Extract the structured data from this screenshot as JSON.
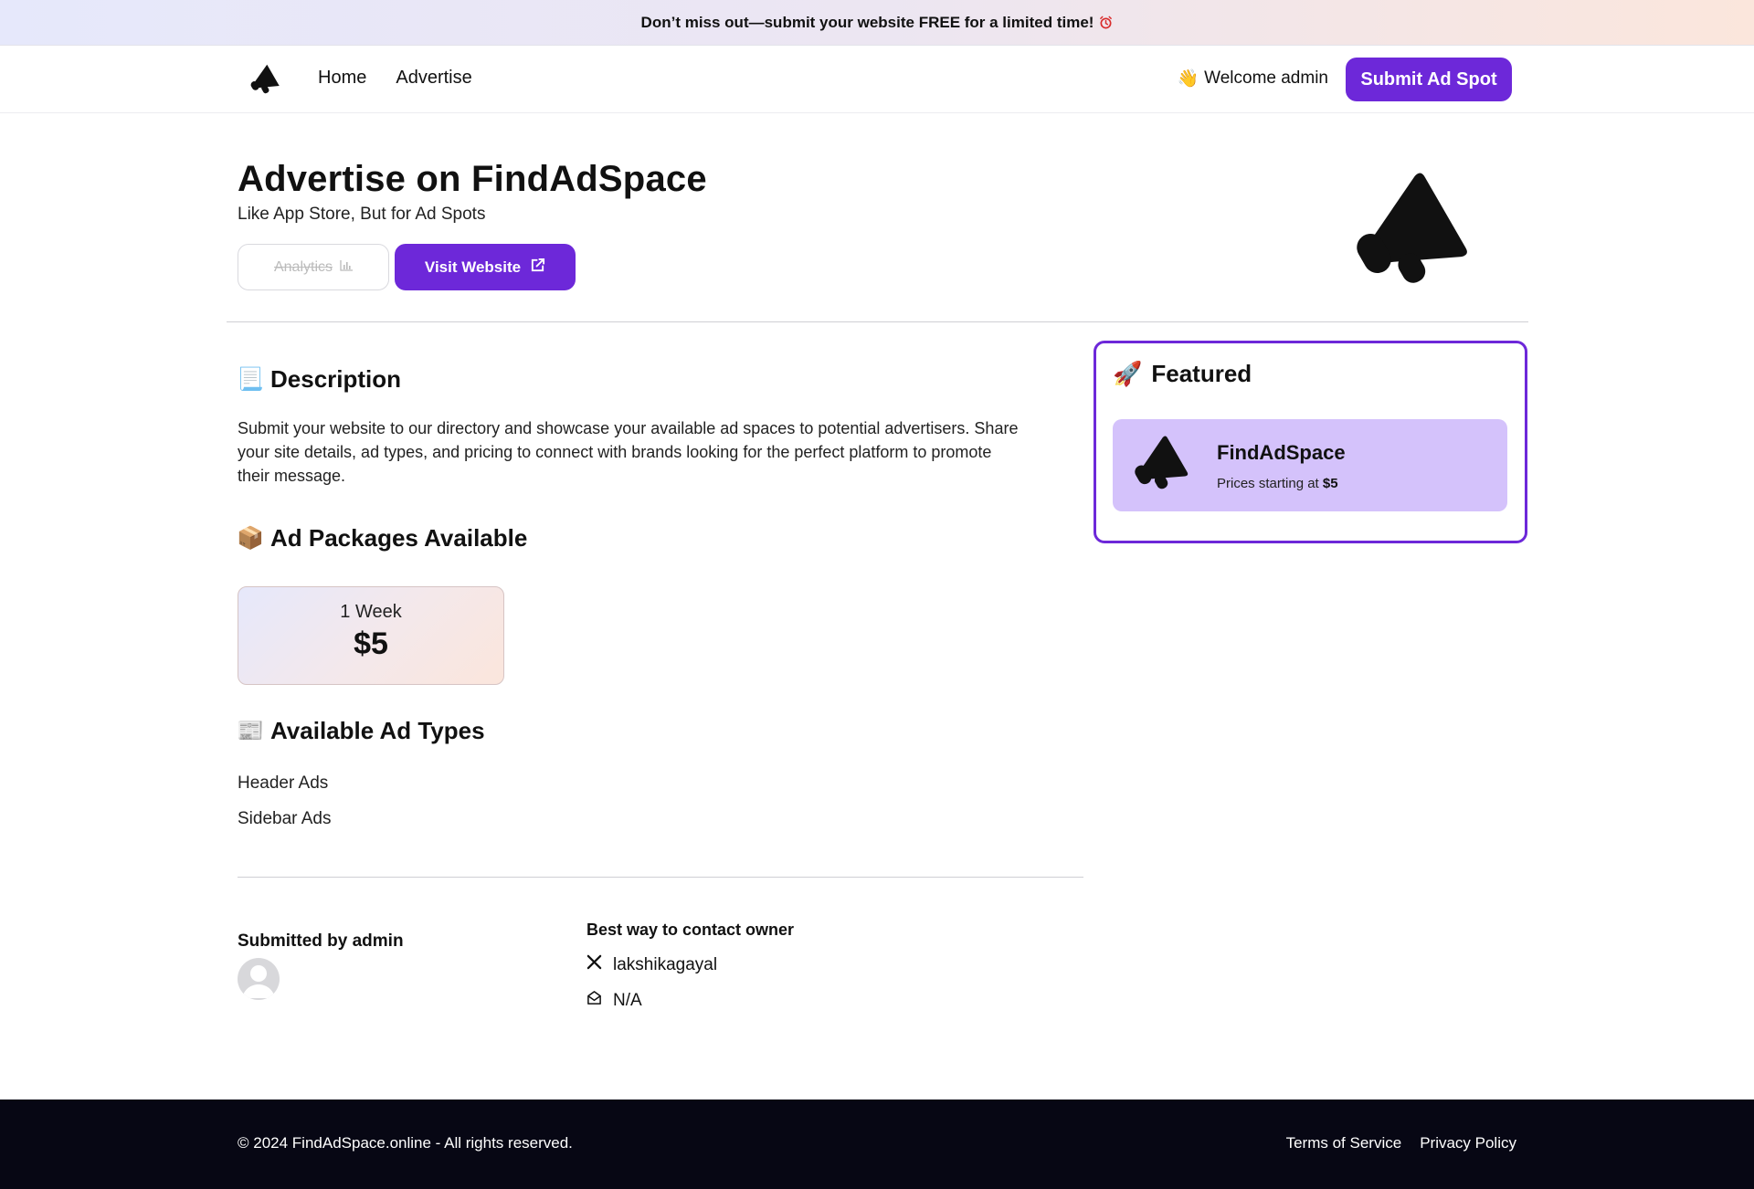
{
  "banner": {
    "text": "Don’t miss out—submit your website FREE for a limited time!",
    "icon": "alarm-clock-icon"
  },
  "nav": {
    "links": [
      "Home",
      "Advertise"
    ],
    "welcome": "Welcome admin",
    "welcome_icon": "waving-hand-icon",
    "submit_label": "Submit Ad Spot"
  },
  "hero": {
    "title": "Advertise on FindAdSpace",
    "subtitle": "Like App Store, But for Ad Spots",
    "analytics_label": "Analytics",
    "visit_label": "Visit Website"
  },
  "sections": {
    "description_title": "Description",
    "description_text": "Submit your website to our directory and showcase your available ad spaces to potential advertisers. Share your site details, ad types, and pricing to connect with brands looking for the perfect platform to promote their message.",
    "packages_title": "Ad Packages Available",
    "adtypes_title": "Available Ad Types"
  },
  "packages": [
    {
      "duration": "1 Week",
      "price": "$5"
    }
  ],
  "ad_types": [
    "Header Ads",
    "Sidebar Ads"
  ],
  "owner": {
    "submitted_by": "Submitted by admin",
    "contact_title": "Best way to contact owner",
    "x_handle": "lakshikagayal",
    "email": "N/A"
  },
  "featured": {
    "title": "Featured",
    "item_name": "FindAdSpace",
    "price_prefix": "Prices starting at",
    "price": "$5"
  },
  "footer": {
    "copyright": "© 2024 FindAdSpace.online - All rights reserved.",
    "terms": "Terms of Service",
    "privacy": "Privacy Policy"
  },
  "colors": {
    "accent": "#6d28d9",
    "featured_card": "#d4c2fb",
    "footer_bg": "#070714"
  }
}
